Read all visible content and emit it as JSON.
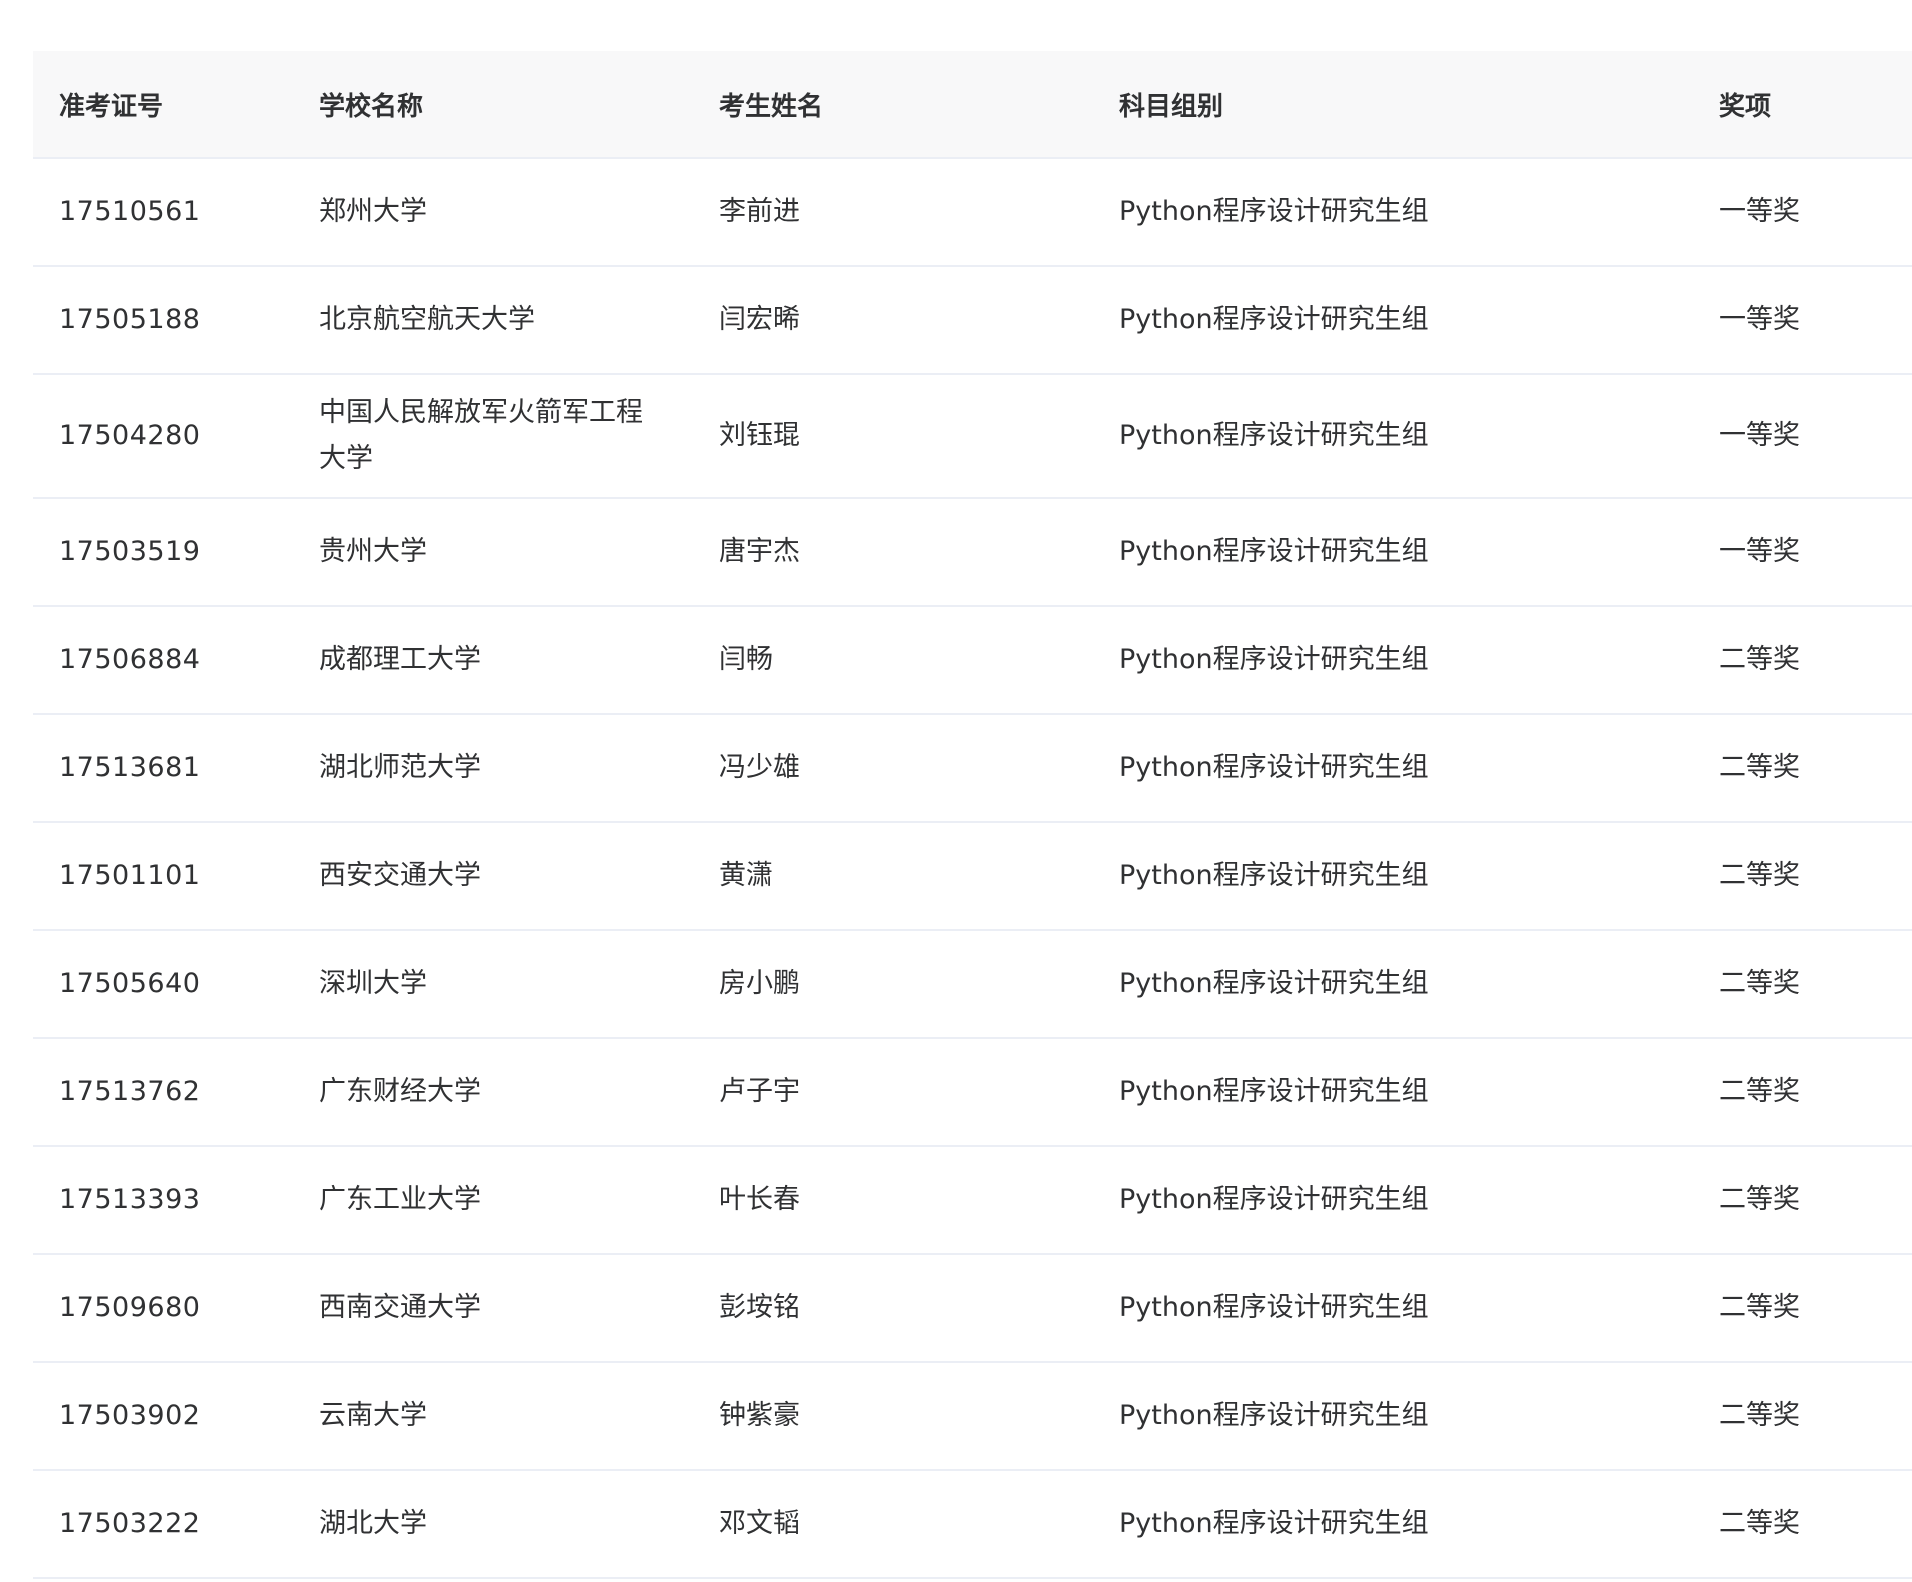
{
  "table": {
    "headers": {
      "id": "准考证号",
      "school": "学校名称",
      "name": "考生姓名",
      "group": "科目组别",
      "award": "奖项"
    },
    "rows": [
      {
        "id": "17510561",
        "school": "郑州大学",
        "name": "李前进",
        "group": "Python程序设计研究生组",
        "award": "一等奖"
      },
      {
        "id": "17505188",
        "school": "北京航空航天大学",
        "name": "闫宏晞",
        "group": "Python程序设计研究生组",
        "award": "一等奖"
      },
      {
        "id": "17504280",
        "school": "中国人民解放军火箭军工程大学",
        "name": "刘钰琨",
        "group": "Python程序设计研究生组",
        "award": "一等奖"
      },
      {
        "id": "17503519",
        "school": "贵州大学",
        "name": "唐宇杰",
        "group": "Python程序设计研究生组",
        "award": "一等奖"
      },
      {
        "id": "17506884",
        "school": "成都理工大学",
        "name": "闫畅",
        "group": "Python程序设计研究生组",
        "award": "二等奖"
      },
      {
        "id": "17513681",
        "school": "湖北师范大学",
        "name": "冯少雄",
        "group": "Python程序设计研究生组",
        "award": "二等奖"
      },
      {
        "id": "17501101",
        "school": "西安交通大学",
        "name": "黄潇",
        "group": "Python程序设计研究生组",
        "award": "二等奖"
      },
      {
        "id": "17505640",
        "school": "深圳大学",
        "name": "房小鹏",
        "group": "Python程序设计研究生组",
        "award": "二等奖"
      },
      {
        "id": "17513762",
        "school": "广东财经大学",
        "name": "卢子宇",
        "group": "Python程序设计研究生组",
        "award": "二等奖"
      },
      {
        "id": "17513393",
        "school": "广东工业大学",
        "name": "叶长春",
        "group": "Python程序设计研究生组",
        "award": "二等奖"
      },
      {
        "id": "17509680",
        "school": "西南交通大学",
        "name": "彭垵铭",
        "group": "Python程序设计研究生组",
        "award": "二等奖"
      },
      {
        "id": "17503902",
        "school": "云南大学",
        "name": "钟紫豪",
        "group": "Python程序设计研究生组",
        "award": "二等奖"
      },
      {
        "id": "17503222",
        "school": "湖北大学",
        "name": "邓文韬",
        "group": "Python程序设计研究生组",
        "award": "二等奖"
      }
    ]
  }
}
